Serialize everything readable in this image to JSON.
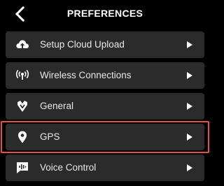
{
  "header": {
    "title": "PREFERENCES",
    "back_icon": "chevron-left-icon"
  },
  "menu": {
    "items": [
      {
        "label": "Setup Cloud Upload",
        "icon": "cloud-upload-icon",
        "selected": false
      },
      {
        "label": "Wireless Connections",
        "icon": "wireless-icon",
        "selected": false
      },
      {
        "label": "General",
        "icon": "general-icon",
        "selected": false
      },
      {
        "label": "GPS",
        "icon": "location-pin-icon",
        "selected": true
      },
      {
        "label": "Voice Control",
        "icon": "voice-control-icon",
        "selected": false
      }
    ],
    "row_icon": "play-arrow-icon"
  },
  "colors": {
    "background": "#000000",
    "row_background": "#2b2b2b",
    "text": "#e8e8e8",
    "highlight": "#e2504c"
  }
}
